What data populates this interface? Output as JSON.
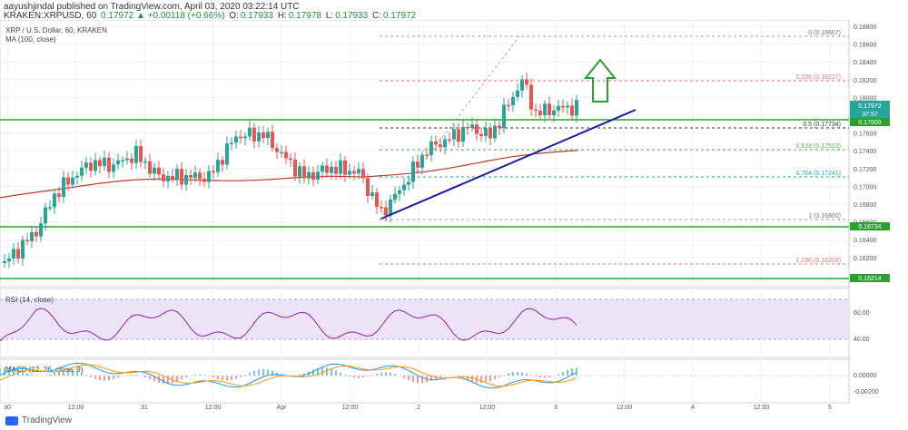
{
  "header": {
    "published_line": "aayushjindal published on TradingView.com, April 03, 2020 03:22:14 UTC",
    "symbol_label": "KRAKEN:XRPUSD, 60",
    "change": "0.17972 ▲ +0.00118 (+0.66%)",
    "ohlc_o_label": "O:",
    "ohlc_o": "0.17933",
    "ohlc_h_label": "H:",
    "ohlc_h": "0.17978",
    "ohlc_l_label": "L:",
    "ohlc_l": "0.17933",
    "ohlc_c_label": "C:",
    "ohlc_c": "0.17972"
  },
  "main_pane": {
    "title": "XRP / U.S. Dollar, 60, KRAKEN",
    "ma_label": "MA (100, close)"
  },
  "price_axis": {
    "ticks": [
      "0.18800",
      "0.18600",
      "0.18400",
      "0.18200",
      "0.18000",
      "0.17800",
      "0.17600",
      "0.17400",
      "0.17200",
      "0.17000",
      "0.16800",
      "0.16600",
      "0.16400",
      "0.16200"
    ],
    "current_price": "0.17972",
    "countdown": "37:57",
    "level_labels": [
      "0.17809",
      "0.16734",
      "0.16214"
    ]
  },
  "fib_levels": [
    {
      "label": "0 (0.18667)"
    },
    {
      "label": "0.236 (0.18227)"
    },
    {
      "label": "0.5 (0.17734)"
    },
    {
      "label": "0.618 (0.17513)"
    },
    {
      "label": "0.764 (0.17241)"
    },
    {
      "label": "1 (0.16800)"
    },
    {
      "label": "1.236 (0.16359)"
    }
  ],
  "rsi_pane": {
    "title": "RSI (14, close)",
    "ticks": [
      "60.00",
      "40.00"
    ]
  },
  "macd_pane": {
    "title": "MACD (12, 26, close, 9)",
    "ticks": [
      "0.00000",
      "-0.00200"
    ]
  },
  "time_axis": {
    "labels": [
      "30",
      "12:00",
      "31",
      "12:00",
      "Apr",
      "12:00",
      "2",
      "12:00",
      "3",
      "12:00",
      "4",
      "12:00",
      "5"
    ]
  },
  "footer": {
    "brand": "TradingView"
  },
  "colors": {
    "up": "#26a69a",
    "down": "#ef5350",
    "ma": "#c0392b",
    "hline": "#2ca02c",
    "trend": "#1a1aa8",
    "arrow": "#2ca02c",
    "rsi_line": "#8e24aa",
    "rsi_band": "#e9dcf5",
    "macd_line": "#2196f3",
    "signal_line": "#ff9800"
  }
}
